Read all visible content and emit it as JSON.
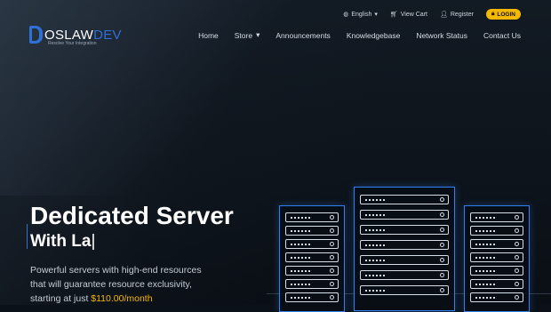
{
  "brand": {
    "name_part1": "OSLAW",
    "name_part2": "DEV",
    "tagline": "Resolve Your Integration"
  },
  "topbar": {
    "language": "English",
    "cart": "View Cart",
    "register": "Register",
    "login": "LOGIN"
  },
  "nav": {
    "items": [
      "Home",
      "Store",
      "Announcements",
      "Knowledgebase",
      "Network Status",
      "Contact Us"
    ]
  },
  "hero": {
    "title": "Dedicated Server",
    "subtitle": "With La",
    "cursor": "|",
    "desc_line1": "Powerful servers with high-end resources",
    "desc_line2": "that will guarantee resource exclusivity,",
    "desc_line3_prefix": "starting at just ",
    "price": "$110.00/month"
  },
  "colors": {
    "accent": "#2f6fd6",
    "highlight": "#f5b800",
    "background": "#0b1118"
  }
}
